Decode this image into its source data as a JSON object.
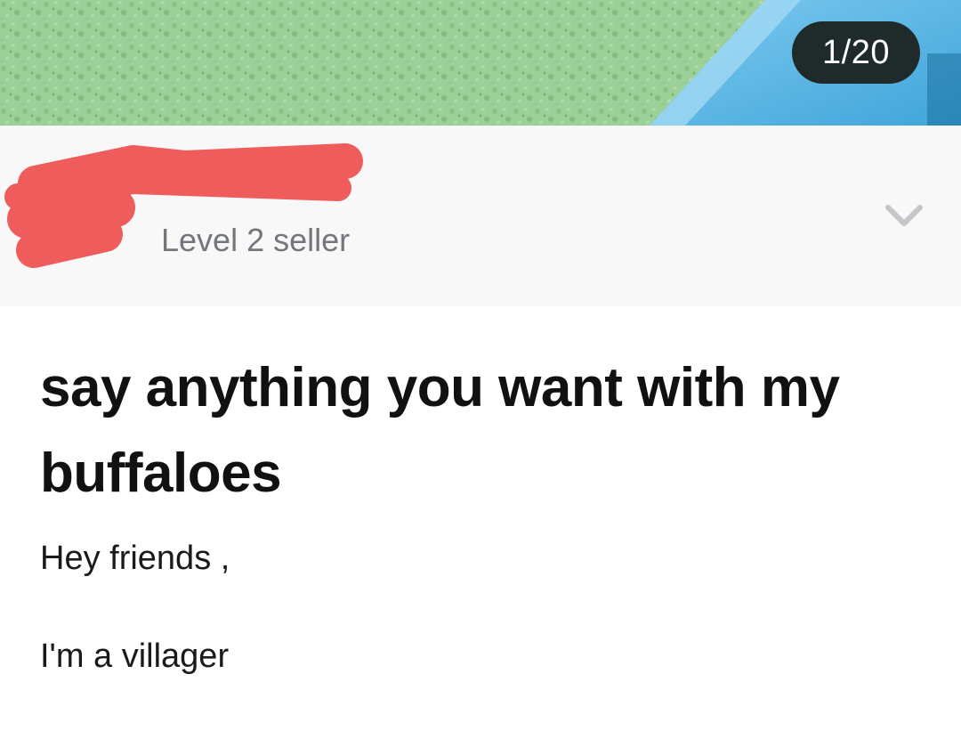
{
  "gallery": {
    "counter": "1/20",
    "colors": {
      "grass": "#8fc98c",
      "object": "#56b4e4",
      "counter_bg": "#1f2b2b"
    }
  },
  "seller": {
    "level": "Level 2 seller",
    "redaction_color": "#ee5c5c",
    "expand_icon": "chevron-down"
  },
  "gig": {
    "title": "say anything you want with my buffaloes",
    "description": [
      "Hey friends ,",
      "I'm a villager"
    ]
  }
}
